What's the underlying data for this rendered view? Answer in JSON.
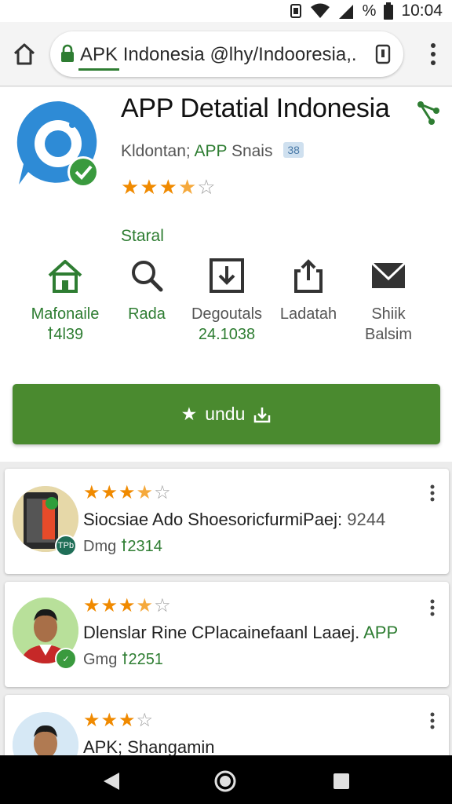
{
  "status_bar": {
    "battery_percent": "%",
    "time": "10:04"
  },
  "browser": {
    "url_secure_part": "APK Indonesia @lhy/Indooresia,."
  },
  "app": {
    "title": "APP Detatial Indonesia",
    "developer": "Kldontan;",
    "developer_tag": "APP",
    "developer_suffix": "Snais",
    "badge": "38",
    "rating": 3.5,
    "rating_stars": "★★★",
    "rating_half": "★",
    "rating_empty": "☆",
    "status": "Staral"
  },
  "stats": [
    {
      "label": "Mafonaile",
      "value": "ꝉ4l39",
      "icon": "home-icon"
    },
    {
      "label": "Rada",
      "value": "",
      "icon": "search-icon"
    },
    {
      "label": "Degoutals",
      "value": "24.1038",
      "icon": "download-box-icon"
    },
    {
      "label": "Ladatah",
      "value": "",
      "icon": "share-up-icon"
    },
    {
      "label": "Shiik",
      "value": "Balsim",
      "icon": "mail-icon"
    }
  ],
  "download_button": {
    "label": "undu"
  },
  "reviews": [
    {
      "rating": 3.5,
      "stars": "★★★",
      "half": "★",
      "empty": "☆",
      "title": "Siocsiae Ado ShoesoricfurmiPaej:",
      "title_number": "9244",
      "sub_prefix": "Dmg",
      "sub_value": "ꝉ2314",
      "badge": "TPb"
    },
    {
      "rating": 3.5,
      "stars": "★★★",
      "half": "★",
      "empty": "☆",
      "title": "Dlenslar Rine CPlacainefaanl Laaej.",
      "title_tag": "APP",
      "sub_prefix": "Gmg",
      "sub_value": "ꝉ2251",
      "badge": "✓"
    },
    {
      "rating": 3,
      "stars": "★★★",
      "half": "",
      "empty": "☆",
      "title": "APK; Shangamin"
    }
  ],
  "colors": {
    "accent_green": "#2e7d32",
    "button_green": "#4a8a2f",
    "star_orange": "#f08a00"
  }
}
